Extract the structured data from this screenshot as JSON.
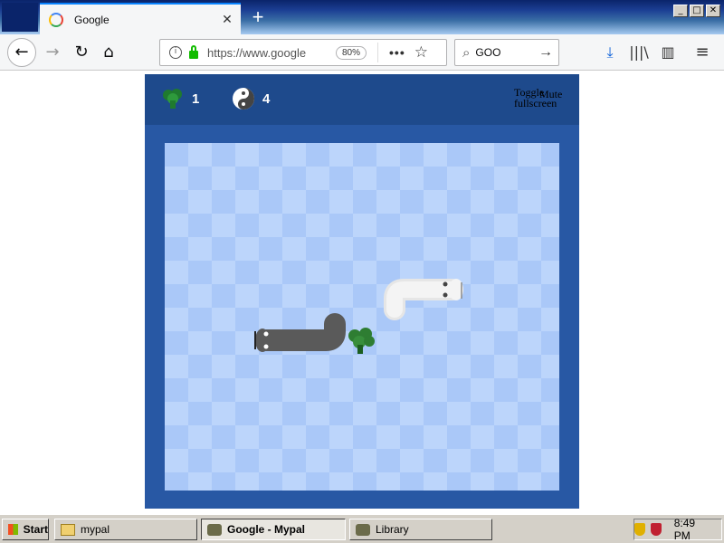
{
  "browser": {
    "tab_title": "Google",
    "tab_close": "✕",
    "new_tab": "+",
    "url": "https://www.google",
    "zoom": "80%",
    "page_actions": "•••",
    "search_query": "GOO",
    "window_controls": [
      "_",
      "□",
      "✕"
    ]
  },
  "game": {
    "hud": {
      "broccoli_count": "1",
      "yinyang_count": "4",
      "toggle_fullscreen": "Toggle fullscreen",
      "mute": "Mute"
    },
    "colors": {
      "board_dark": "#aac8f8",
      "board_light": "#bcd5fb",
      "frame": "#2858a4",
      "hud": "#1e4a8c",
      "snake_dark": "#5a5a5a",
      "snake_light": "#f2f2f2",
      "broccoli": "#2e7d32"
    }
  },
  "taskbar": {
    "start": "Start",
    "items": [
      "mypal",
      "Google - Mypal",
      "Library"
    ],
    "time": "8:49 PM"
  }
}
